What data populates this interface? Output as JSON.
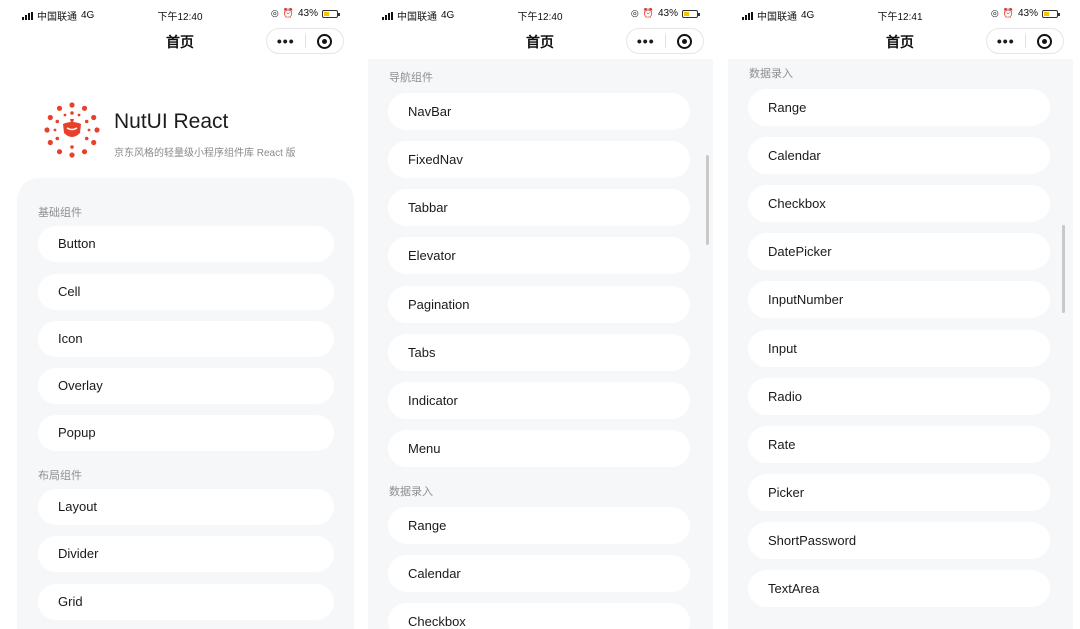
{
  "status": {
    "carrier": "中国联通",
    "network": "4G",
    "alarm": "⏰",
    "location": "◎",
    "battery": "43%",
    "battery_fill": 0.43,
    "times": [
      "下午12:40",
      "下午12:40",
      "下午12:41"
    ]
  },
  "navbar": {
    "title": "首页",
    "more": "•••"
  },
  "brand": {
    "title": "NutUI React",
    "subtitle": "京东风格的轻量级小程序组件库 React 版",
    "logo": "nutui-logo",
    "accent": "#e8412b"
  },
  "panel1": {
    "sections": [
      {
        "title": "基础组件",
        "items": [
          "Button",
          "Cell",
          "Icon",
          "Overlay",
          "Popup"
        ]
      },
      {
        "title": "布局组件",
        "items": [
          "Layout",
          "Divider",
          "Grid"
        ]
      }
    ]
  },
  "panel2": {
    "sections": [
      {
        "title": "导航组件",
        "items": [
          "NavBar",
          "FixedNav",
          "Tabbar",
          "Elevator",
          "Pagination",
          "Tabs",
          "Indicator",
          "Menu"
        ]
      },
      {
        "title": "数据录入",
        "items": [
          "Range",
          "Calendar",
          "Checkbox"
        ]
      }
    ]
  },
  "panel3": {
    "sections": [
      {
        "title": "数据录入",
        "items": [
          "Range",
          "Calendar",
          "Checkbox",
          "DatePicker",
          "InputNumber",
          "Input",
          "Radio",
          "Rate",
          "Picker",
          "ShortPassword",
          "TextArea"
        ]
      }
    ]
  }
}
